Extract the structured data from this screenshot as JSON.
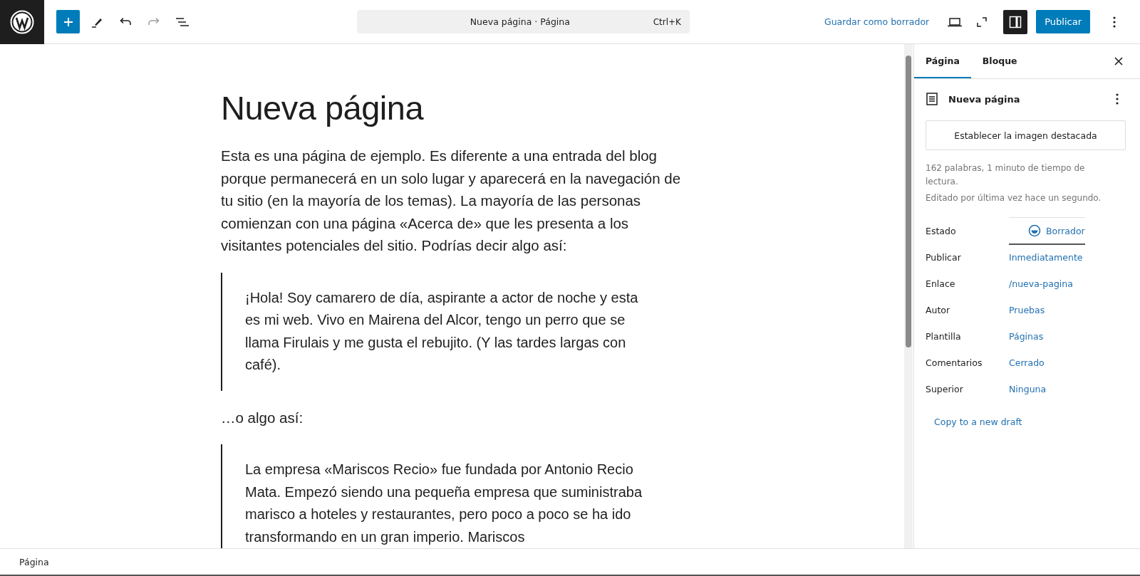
{
  "toolbar": {
    "undo": {
      "disabled": false
    },
    "redo": {
      "disabled": true
    },
    "command_bar": {
      "title": "Nueva página · Página",
      "shortcut": "Ctrl+K"
    },
    "save_draft": "Guardar como borrador",
    "settings_toggle": {
      "selected": true
    },
    "publish": "Publicar"
  },
  "document": {
    "title": "Nueva página",
    "blocks": [
      {
        "kind": "paragraph",
        "text": "Esta es una página de ejemplo. Es diferente a una entrada del blog porque permanecerá en un solo lugar y aparecerá en la navegación de tu sitio (en la mayoría de los temas). La mayoría de las personas comienzan con una página «Acerca de» que les presenta a los visitantes potenciales del sitio. Podrías decir algo así:"
      },
      {
        "kind": "quote",
        "text": "¡Hola! Soy camarero de día, aspirante a actor de noche y esta es mi web. Vivo en Mairena del Alcor, tengo un perro que se llama Firulais y me gusta el rebujito. (Y las tardes largas con café)."
      },
      {
        "kind": "paragraph",
        "text": "…o algo así:"
      },
      {
        "kind": "quote",
        "text": "La empresa «Mariscos Recio» fue fundada por Antonio Recio Mata. Empezó siendo una pequeña empresa que suministraba marisco a hoteles y restaurantes, pero poco a poco se ha ido transformando en un gran imperio. Mariscos"
      }
    ]
  },
  "sidebar": {
    "tabs": [
      {
        "label": "Página",
        "selected": true
      },
      {
        "label": "Bloque",
        "selected": false
      }
    ],
    "post_title": "Nueva página",
    "featured_image_button": "Establecer la imagen destacada",
    "stats": [
      "162 palabras, 1 minuto de tiempo de lectura.",
      "Editado por última vez hace un segundo."
    ],
    "fields": [
      {
        "label": "Estado",
        "value": "Borrador",
        "kind": "status"
      },
      {
        "label": "Publicar",
        "value": "Inmediatamente",
        "kind": "link"
      },
      {
        "label": "Enlace",
        "value": "/nueva-pagina",
        "kind": "link"
      },
      {
        "label": "Autor",
        "value": "Pruebas",
        "kind": "link"
      },
      {
        "label": "Plantilla",
        "value": "Páginas",
        "kind": "link"
      },
      {
        "label": "Comentarios",
        "value": "Cerrado",
        "kind": "link"
      },
      {
        "label": "Superior",
        "value": "Ninguna",
        "kind": "link"
      }
    ],
    "copy_link": "Copy to a new draft"
  },
  "status_bar": {
    "breadcrumb": "Página"
  }
}
